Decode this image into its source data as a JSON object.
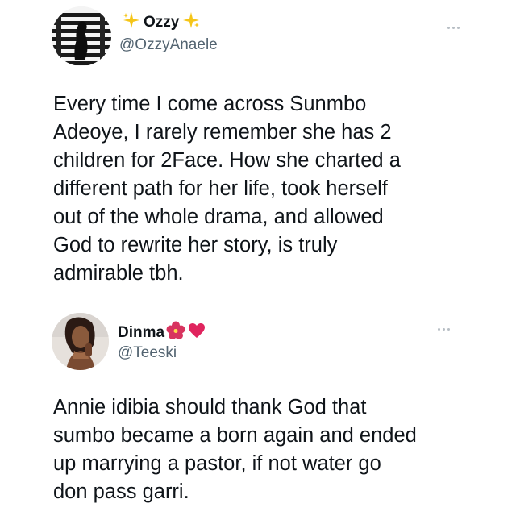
{
  "tweets": [
    {
      "display_name": "Ozzy",
      "handle": "@OzzyAnaele",
      "text": "Every time I come across Sunmbo\nAdeoye, I rarely remember she has 2\nchildren for 2Face. How she charted a\ndifferent path for her life, took herself\nout of the whole drama, and allowed\nGod to rewrite her story, is truly\nadmirable tbh.",
      "name_decoration_icon": "sparkles-icon",
      "avatar_icon": "striped-portrait-avatar",
      "more_icon": "more-options-icon"
    },
    {
      "display_name": "Dinma",
      "handle": "@Teeski",
      "text": "Annie idibia should thank God that\nsumbo became a born again and ended\nup marrying a pastor, if not water go\ndon pass garri.",
      "name_emojis": [
        "hibiscus-icon",
        "red-heart-icon"
      ],
      "avatar_icon": "woman-portrait-avatar",
      "more_icon": "more-options-icon"
    }
  ],
  "colors": {
    "text": "#0f1419",
    "secondary_text": "#536471",
    "sparkle": "#f5c518",
    "heart": "#e0245e",
    "hibiscus": "#d8345f",
    "more_dots": "#b7bec4"
  }
}
